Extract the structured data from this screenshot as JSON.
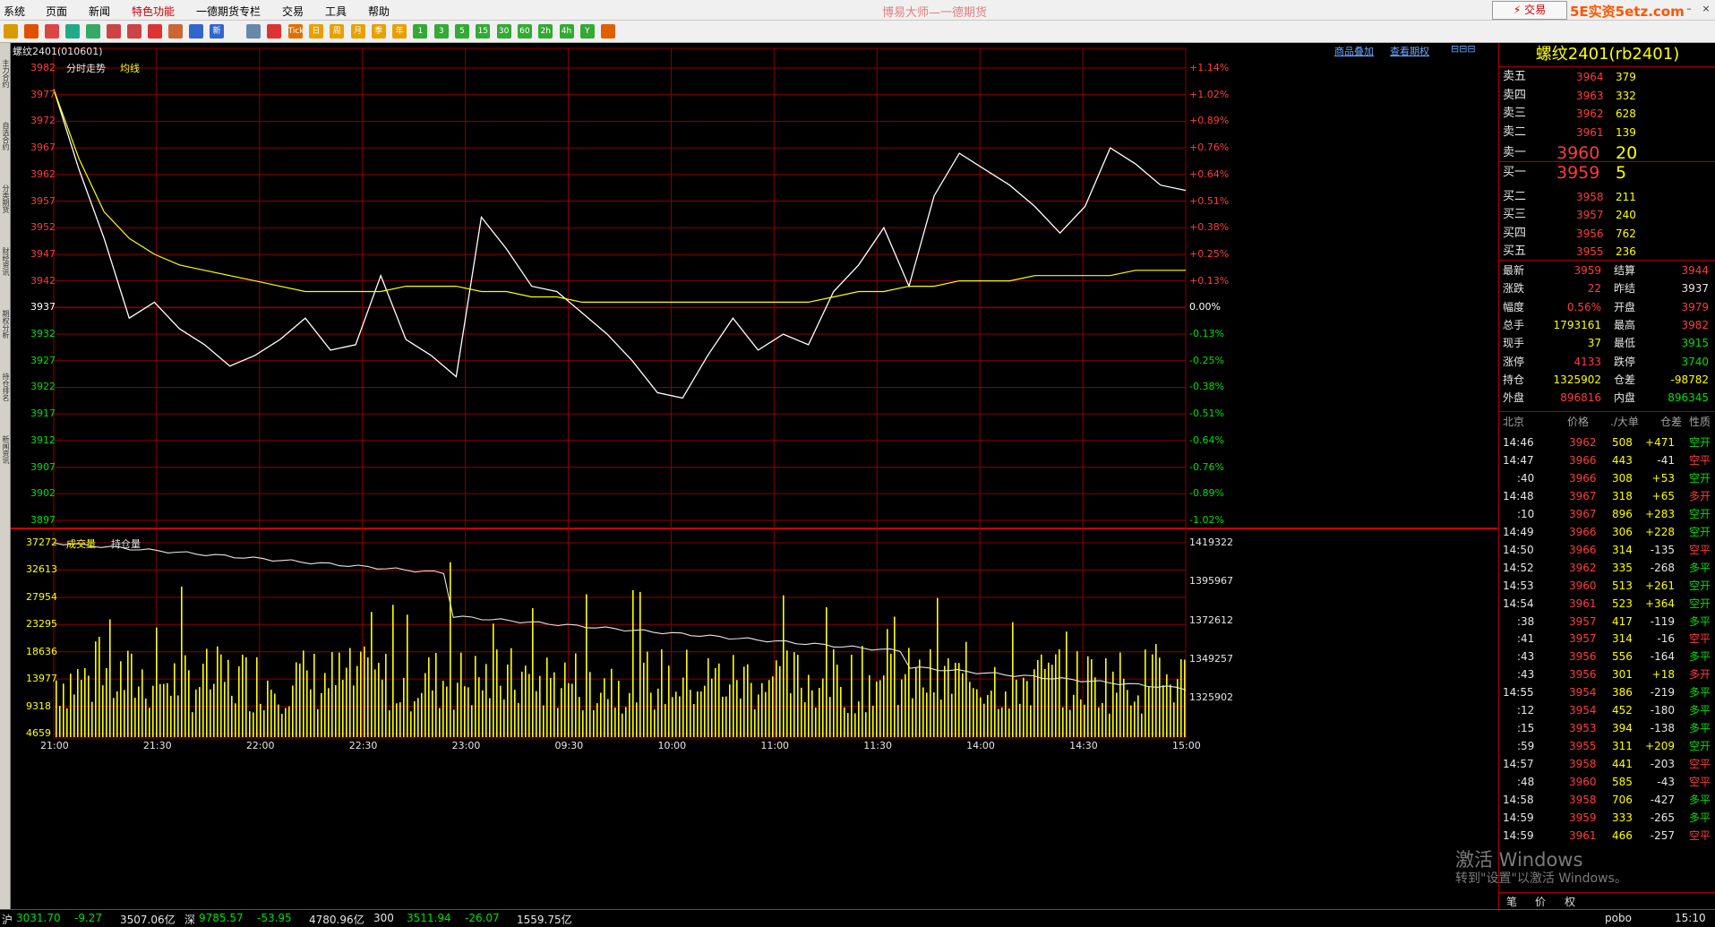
{
  "menu": {
    "items": [
      "系统",
      "页面",
      "新闻",
      "特色功能",
      "一德期货专栏",
      "交易",
      "工具",
      "帮助"
    ]
  },
  "app_title": "博易大师—一德期货",
  "trade_button": "⚡ 交易",
  "watermark_logo": "5E实资5etz.com",
  "toolbar": {
    "icons": [
      "back-icon",
      "home-icon",
      "news-icon",
      "refresh-icon",
      "list-icon",
      "zoom-in-icon",
      "zoom-out-icon",
      "draw-icon",
      "tools-icon",
      "filter-icon",
      "new-icon",
      "sheet-icon",
      "timeshare-icon",
      "tick-icon",
      "day-icon",
      "week-icon",
      "month-icon",
      "quarter-icon",
      "year-icon",
      "1min-icon",
      "3min-icon",
      "5min-icon",
      "15min-icon",
      "30min-icon",
      "60min-icon",
      "2h-icon",
      "4h-icon",
      "yearly-icon",
      "calendar-icon"
    ],
    "labels": [
      "",
      "",
      "",
      "",
      "",
      "",
      "",
      "",
      "",
      "",
      "新",
      "",
      "",
      "Tick",
      "日",
      "周",
      "月",
      "季",
      "年",
      "1",
      "3",
      "5",
      "15",
      "30",
      "60",
      "2h",
      "4h",
      "Y",
      ""
    ]
  },
  "left_tabs": [
    "主力合约",
    "自选合约",
    "分类期货",
    "财经资讯",
    "期权分析",
    "持仓排名",
    "新闻资讯"
  ],
  "chart": {
    "symbol": "螺纹2401(010601)",
    "link_overlay": "商品叠加",
    "link_options": "查看期权",
    "legend_price": "分时走势",
    "legend_avg": "均线",
    "legend_vol": "成交量",
    "legend_oi": "持仓量",
    "price_ticks": [
      "3982",
      "3977",
      "3972",
      "3967",
      "3962",
      "3957",
      "3952",
      "3947",
      "3942",
      "3937",
      "3932",
      "3927",
      "3922",
      "3917",
      "3912",
      "3907",
      "3902",
      "3897"
    ],
    "pct_ticks": [
      "+1.14%",
      "+1.02%",
      "+0.89%",
      "+0.76%",
      "+0.64%",
      "+0.51%",
      "+0.38%",
      "+0.25%",
      "+0.13%",
      "0.00%",
      "-0.13%",
      "-0.25%",
      "-0.38%",
      "-0.51%",
      "-0.64%",
      "-0.76%",
      "-0.89%",
      "-1.02%"
    ],
    "vol_ticks": [
      "37272",
      "32613",
      "27954",
      "23295",
      "18636",
      "13977",
      "9318",
      "4659"
    ],
    "oi_ticks": [
      "1419322",
      "1395967",
      "1372612",
      "1349257",
      "1325902"
    ],
    "time_labels": [
      "21:00",
      "21:30",
      "22:00",
      "22:30",
      "23:00",
      "09:30",
      "10:00",
      "11:00",
      "11:30",
      "14:00",
      "14:30",
      "15:00"
    ],
    "colors": {
      "price": "#ffffff",
      "avg": "#ffff00",
      "grid": "#8b0000",
      "up": "#ff3b3b",
      "down": "#00e000",
      "volume": "#ffff00"
    }
  },
  "chart_data": {
    "type": "line",
    "x_labels": [
      "21:00",
      "21:30",
      "22:00",
      "22:30",
      "23:00",
      "09:30",
      "10:00",
      "11:00",
      "11:30",
      "14:00",
      "14:30",
      "15:00"
    ],
    "ylim": [
      3897,
      3982
    ],
    "series": [
      {
        "name": "分时走势",
        "values": [
          3978,
          3963,
          3950,
          3935,
          3938,
          3933,
          3930,
          3926,
          3928,
          3931,
          3935,
          3929,
          3930,
          3943,
          3931,
          3928,
          3924,
          3954,
          3948,
          3941,
          3940,
          3936,
          3932,
          3927,
          3921,
          3920,
          3928,
          3935,
          3929,
          3932,
          3930,
          3940,
          3945,
          3952,
          3941,
          3958,
          3966,
          3963,
          3960,
          3956,
          3951,
          3956,
          3967,
          3964,
          3960,
          3959
        ]
      },
      {
        "name": "均线",
        "values": [
          3978,
          3965,
          3955,
          3950,
          3947,
          3945,
          3944,
          3943,
          3942,
          3941,
          3940,
          3940,
          3940,
          3940,
          3941,
          3941,
          3941,
          3940,
          3940,
          3939,
          3939,
          3938,
          3938,
          3938,
          3938,
          3938,
          3938,
          3938,
          3938,
          3938,
          3938,
          3939,
          3940,
          3940,
          3941,
          3941,
          3942,
          3942,
          3942,
          3943,
          3943,
          3943,
          3943,
          3944,
          3944,
          3944
        ]
      }
    ],
    "volume": {
      "ylim": [
        0,
        37272
      ]
    },
    "open_interest": {
      "ylim": [
        1325902,
        1419322
      ],
      "start": 1419322,
      "end": 1325902
    }
  },
  "quote": {
    "title": "螺纹2401(rb2401)",
    "asks": [
      {
        "label": "卖五",
        "price": "3964",
        "vol": "379"
      },
      {
        "label": "卖四",
        "price": "3963",
        "vol": "332"
      },
      {
        "label": "卖三",
        "price": "3962",
        "vol": "628"
      },
      {
        "label": "卖二",
        "price": "3961",
        "vol": "139"
      },
      {
        "label": "卖一",
        "price": "3960",
        "vol": "20"
      }
    ],
    "bids": [
      {
        "label": "买一",
        "price": "3959",
        "vol": "5"
      },
      {
        "label": "买二",
        "price": "3958",
        "vol": "211"
      },
      {
        "label": "买三",
        "price": "3957",
        "vol": "240"
      },
      {
        "label": "买四",
        "price": "3956",
        "vol": "762"
      },
      {
        "label": "买五",
        "price": "3955",
        "vol": "236"
      }
    ],
    "stats": [
      {
        "l1": "最新",
        "v1": "3959",
        "c1": "red",
        "l2": "结算",
        "v2": "3944",
        "c2": "red"
      },
      {
        "l1": "涨跌",
        "v1": "22",
        "c1": "red",
        "l2": "昨结",
        "v2": "3937",
        "c2": "white"
      },
      {
        "l1": "幅度",
        "v1": "0.56%",
        "c1": "red",
        "l2": "开盘",
        "v2": "3979",
        "c2": "red"
      },
      {
        "l1": "总手",
        "v1": "1793161",
        "c1": "yellow",
        "l2": "最高",
        "v2": "3982",
        "c2": "red"
      },
      {
        "l1": "现手",
        "v1": "37",
        "c1": "yellow",
        "l2": "最低",
        "v2": "3915",
        "c2": "green"
      },
      {
        "l1": "涨停",
        "v1": "4133",
        "c1": "red",
        "l2": "跌停",
        "v2": "3740",
        "c2": "green"
      },
      {
        "l1": "持仓",
        "v1": "1325902",
        "c1": "yellow",
        "l2": "仓差",
        "v2": "-98782",
        "c2": "yellow"
      },
      {
        "l1": "外盘",
        "v1": "896816",
        "c1": "red",
        "l2": "内盘",
        "v2": "896345",
        "c2": "green"
      }
    ],
    "tick_header": [
      "北京",
      "价格",
      "./大单",
      "仓差",
      "性质"
    ],
    "ticks": [
      [
        "14:46",
        "3962",
        "508",
        "+471",
        "空开"
      ],
      [
        "14:47",
        "3966",
        "443",
        "-41",
        "空平"
      ],
      [
        ":40",
        "3966",
        "308",
        "+53",
        "空开"
      ],
      [
        "14:48",
        "3967",
        "318",
        "+65",
        "多开"
      ],
      [
        ":10",
        "3967",
        "896",
        "+283",
        "空开"
      ],
      [
        "14:49",
        "3966",
        "306",
        "+228",
        "空开"
      ],
      [
        "14:50",
        "3966",
        "314",
        "-135",
        "空平"
      ],
      [
        "14:52",
        "3962",
        "335",
        "-268",
        "多平"
      ],
      [
        "14:53",
        "3960",
        "513",
        "+261",
        "空开"
      ],
      [
        "14:54",
        "3961",
        "523",
        "+364",
        "空开"
      ],
      [
        ":38",
        "3957",
        "417",
        "-119",
        "多平"
      ],
      [
        ":41",
        "3957",
        "314",
        "-16",
        "空平"
      ],
      [
        ":43",
        "3956",
        "556",
        "-164",
        "多平"
      ],
      [
        ":43",
        "3956",
        "301",
        "+18",
        "多开"
      ],
      [
        "14:55",
        "3954",
        "386",
        "-219",
        "多平"
      ],
      [
        ":12",
        "3954",
        "452",
        "-180",
        "多平"
      ],
      [
        ":15",
        "3953",
        "394",
        "-138",
        "多平"
      ],
      [
        ":59",
        "3955",
        "311",
        "+209",
        "空开"
      ],
      [
        "14:57",
        "3958",
        "441",
        "-203",
        "空平"
      ],
      [
        ":48",
        "3960",
        "585",
        "-43",
        "空平"
      ],
      [
        "14:58",
        "3958",
        "706",
        "-427",
        "多平"
      ],
      [
        "14:59",
        "3959",
        "333",
        "-265",
        "多平"
      ],
      [
        "14:59",
        "3961",
        "466",
        "-257",
        "空平"
      ]
    ],
    "tabs": [
      "笔",
      "价",
      "权"
    ]
  },
  "status": [
    {
      "t": "沪",
      "v": "3031.70",
      "c": "green"
    },
    {
      "t": "",
      "v": "-9.27",
      "c": "green"
    },
    {
      "t": "",
      "v": "3507.06亿",
      "c": "white"
    },
    {
      "t": "深",
      "v": "9785.57",
      "c": "green"
    },
    {
      "t": "",
      "v": "-53.95",
      "c": "green"
    },
    {
      "t": "",
      "v": "4780.96亿",
      "c": "white"
    },
    {
      "t": "",
      "v": "300",
      "c": "white"
    },
    {
      "t": "",
      "v": "3511.94",
      "c": "green"
    },
    {
      "t": "",
      "v": "-26.07",
      "c": "green"
    },
    {
      "t": "",
      "v": "1559.75亿",
      "c": "white"
    }
  ],
  "status_right": {
    "user": "pobo",
    "clock": "15:10"
  },
  "os_watermark": {
    "line1": "激活 Windows",
    "line2": "转到\"设置\"以激活 Windows。"
  }
}
